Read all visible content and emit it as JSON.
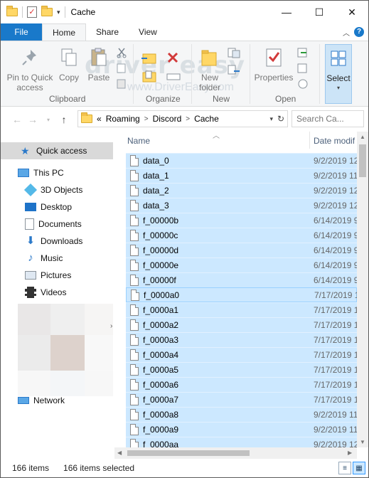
{
  "window": {
    "title": "Cache"
  },
  "ribbon_tabs": [
    "File",
    "Home",
    "Share",
    "View"
  ],
  "ribbon": {
    "clipboard": {
      "pin": "Pin to Quick access",
      "copy": "Copy",
      "paste": "Paste",
      "group": "Clipboard"
    },
    "organize": {
      "group": "Organize"
    },
    "new": {
      "new_folder": "New folder",
      "group": "New"
    },
    "open": {
      "properties": "Properties",
      "group": "Open"
    },
    "select": {
      "label": "Select"
    },
    "watermark": "driver easy",
    "watermark_url": "www.DriverEasy.com"
  },
  "address": {
    "prefix": "«",
    "crumbs": [
      "Roaming",
      "Discord",
      "Cache"
    ],
    "search_placeholder": "Search Ca..."
  },
  "nav": {
    "quick_access": "Quick access",
    "this_pc": "This PC",
    "items": [
      "3D Objects",
      "Desktop",
      "Documents",
      "Downloads",
      "Music",
      "Pictures",
      "Videos"
    ],
    "network": "Network"
  },
  "columns": {
    "name": "Name",
    "date": "Date modif"
  },
  "files": [
    {
      "name": "data_0",
      "date": "9/2/2019 12"
    },
    {
      "name": "data_1",
      "date": "9/2/2019 11"
    },
    {
      "name": "data_2",
      "date": "9/2/2019 12"
    },
    {
      "name": "data_3",
      "date": "9/2/2019 12"
    },
    {
      "name": "f_00000b",
      "date": "6/14/2019 9"
    },
    {
      "name": "f_00000c",
      "date": "6/14/2019 9"
    },
    {
      "name": "f_00000d",
      "date": "6/14/2019 9"
    },
    {
      "name": "f_00000e",
      "date": "6/14/2019 9"
    },
    {
      "name": "f_00000f",
      "date": "6/14/2019 9"
    },
    {
      "name": "f_0000a0",
      "date": "7/17/2019 1"
    },
    {
      "name": "f_0000a1",
      "date": "7/17/2019 1"
    },
    {
      "name": "f_0000a2",
      "date": "7/17/2019 1"
    },
    {
      "name": "f_0000a3",
      "date": "7/17/2019 1"
    },
    {
      "name": "f_0000a4",
      "date": "7/17/2019 1"
    },
    {
      "name": "f_0000a5",
      "date": "7/17/2019 1"
    },
    {
      "name": "f_0000a6",
      "date": "7/17/2019 1"
    },
    {
      "name": "f_0000a7",
      "date": "7/17/2019 1"
    },
    {
      "name": "f_0000a8",
      "date": "9/2/2019 11"
    },
    {
      "name": "f_0000a9",
      "date": "9/2/2019 11"
    },
    {
      "name": "f_0000aa",
      "date": "9/2/2019 12"
    }
  ],
  "status": {
    "count": "166 items",
    "selected": "166 items selected"
  },
  "colors": {
    "accent": "#1979ca",
    "selection": "#cce8ff",
    "nav_selected": "#d9d9d9"
  }
}
